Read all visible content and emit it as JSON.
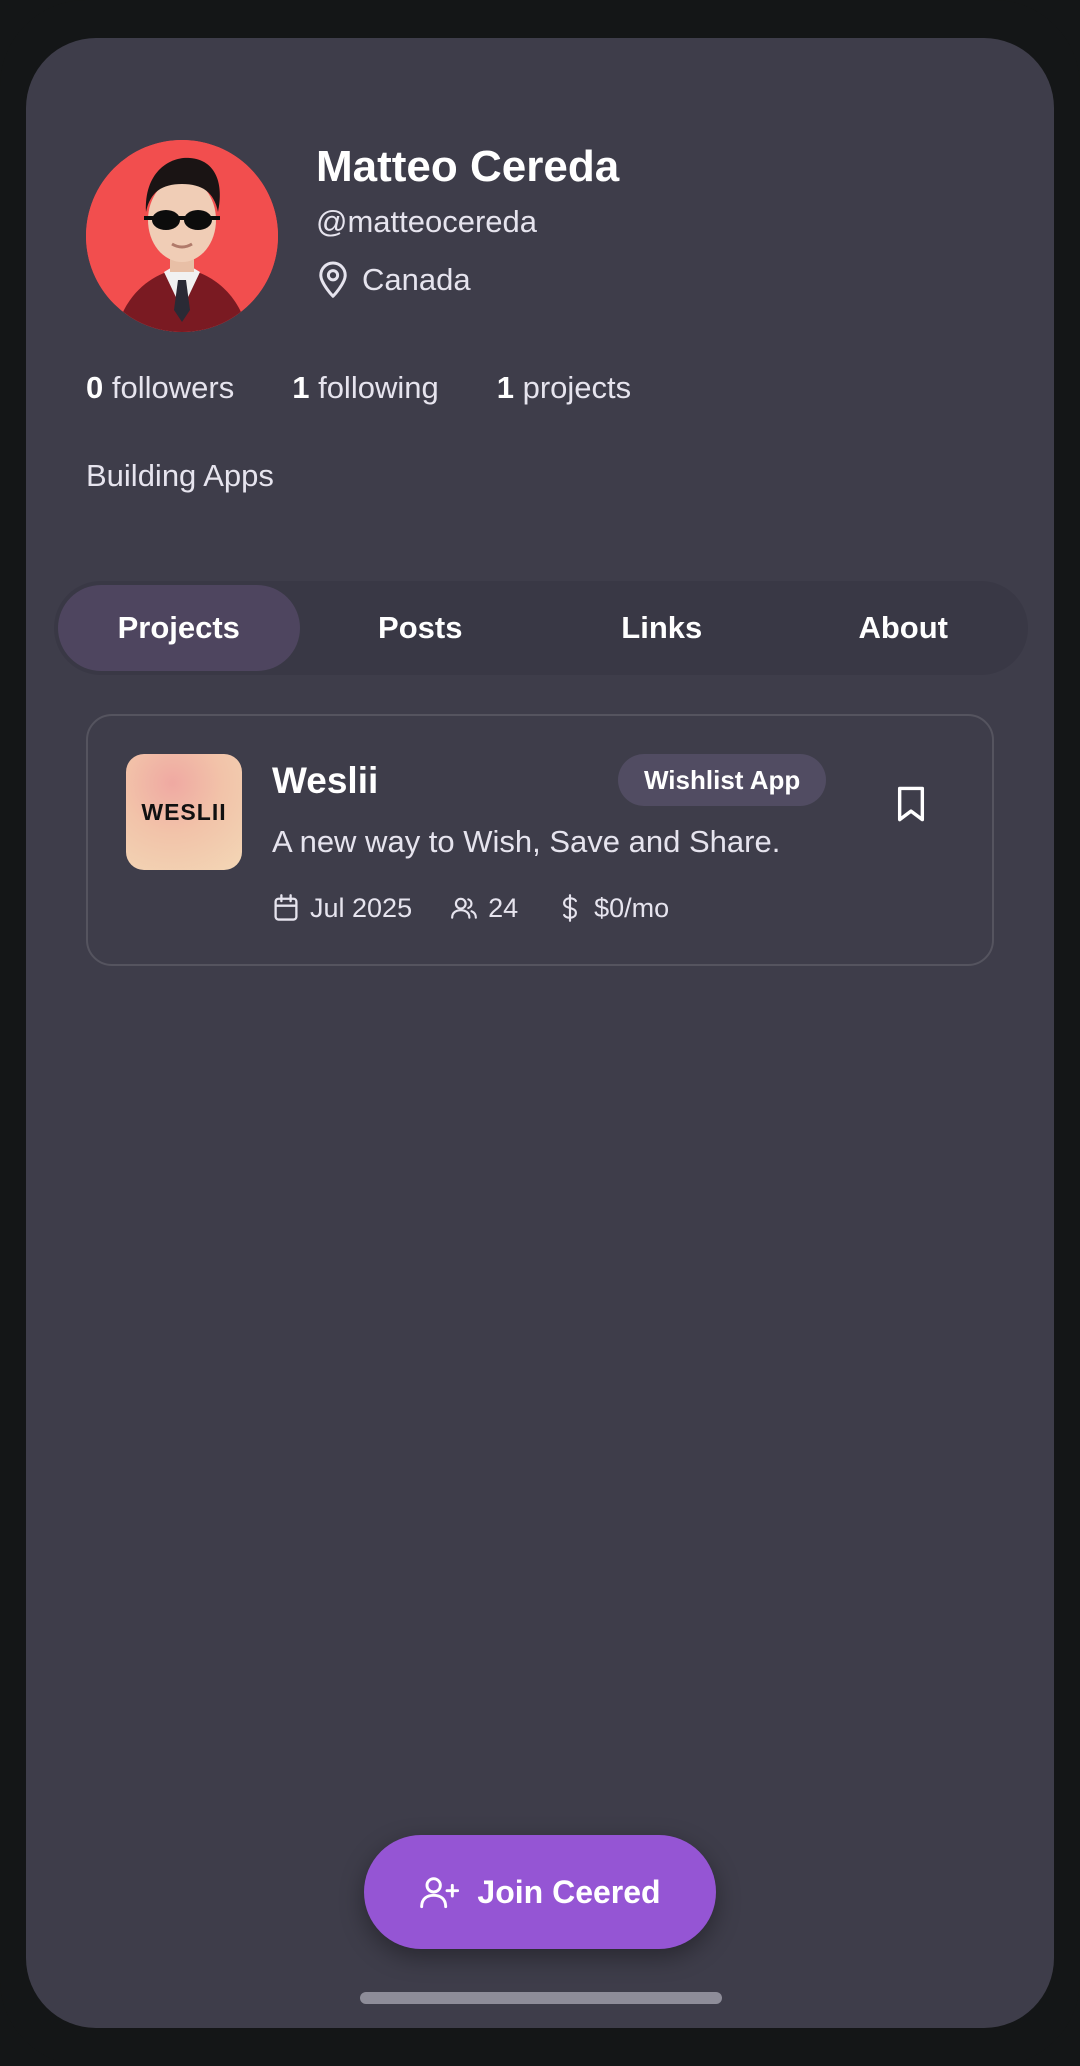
{
  "profile": {
    "name": "Matteo Cereda",
    "handle": "@matteocereda",
    "location": "Canada",
    "avatar_bg": "#f24e4e",
    "stats": [
      {
        "count": "0",
        "label": "followers"
      },
      {
        "count": "1",
        "label": "following"
      },
      {
        "count": "1",
        "label": "projects"
      }
    ],
    "bio": "Building Apps"
  },
  "tabs": [
    {
      "label": "Projects",
      "active": true
    },
    {
      "label": "Posts",
      "active": false
    },
    {
      "label": "Links",
      "active": false
    },
    {
      "label": "About",
      "active": false
    }
  ],
  "project": {
    "logo_text": "WESLII",
    "title": "Weslii",
    "badge": "Wishlist App",
    "description": "A new way to Wish, Save and Share.",
    "date": "Jul 2025",
    "members": "24",
    "revenue": "$0/mo",
    "bookmark_icon": "bookmark-icon"
  },
  "cta": {
    "label": "Join Ceered",
    "icon": "user-plus-icon",
    "color": "#9555d4"
  },
  "theme": {
    "screen_bg": "#3e3d4a",
    "frame_bg": "#141617"
  }
}
